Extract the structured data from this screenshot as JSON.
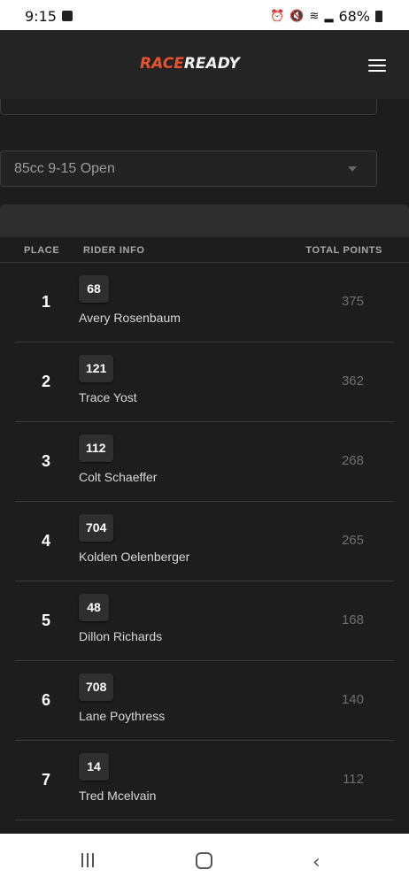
{
  "status_bar": {
    "time": "9:15",
    "battery": "68%",
    "icons": [
      "gallery-icon",
      "alarm-icon",
      "mute-icon",
      "wifi-icon",
      "signal-icon",
      "battery-icon"
    ]
  },
  "header": {
    "logo_part1": "RACE",
    "logo_part2": "READY",
    "menu_icon": "hamburger-menu-icon",
    "brand_color": "#e8532c"
  },
  "filter": {
    "class_value": "85cc 9-15 Open"
  },
  "table": {
    "headers": {
      "place": "PLACE",
      "rider": "RIDER INFO",
      "points": "TOTAL POINTS"
    },
    "rows": [
      {
        "place": "1",
        "number": "68",
        "name": "Avery Rosenbaum",
        "points": "375"
      },
      {
        "place": "2",
        "number": "121",
        "name": "Trace Yost",
        "points": "362"
      },
      {
        "place": "3",
        "number": "112",
        "name": "Colt Schaeffer",
        "points": "268"
      },
      {
        "place": "4",
        "number": "704",
        "name": "Kolden Oelenberger",
        "points": "265"
      },
      {
        "place": "5",
        "number": "48",
        "name": "Dillon Richards",
        "points": "168"
      },
      {
        "place": "6",
        "number": "708",
        "name": "Lane Poythress",
        "points": "140"
      },
      {
        "place": "7",
        "number": "14",
        "name": "Tred Mcelvain",
        "points": "112"
      }
    ]
  },
  "nav_bar": {
    "icons": [
      "recents-icon",
      "home-icon",
      "back-icon"
    ]
  }
}
